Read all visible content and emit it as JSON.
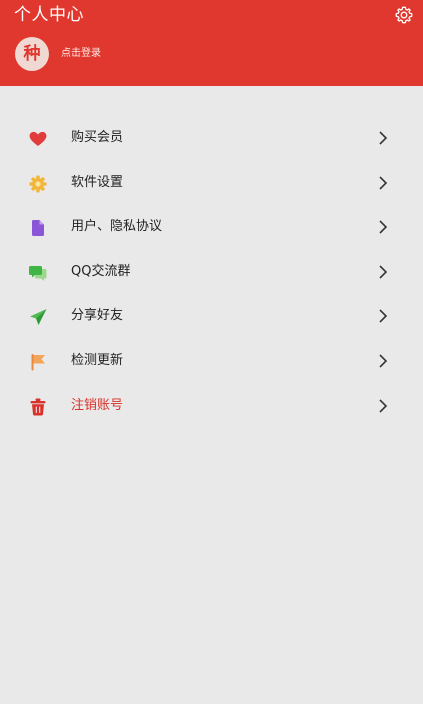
{
  "header": {
    "title": "个人中心",
    "settings_icon": "gear-icon",
    "avatar_text": "种",
    "login_label": "点击登录"
  },
  "colors": {
    "brand": "#e0382f",
    "background": "#e9e9e9",
    "danger_text": "#d9312b"
  },
  "menu": {
    "items": [
      {
        "label": "购买会员",
        "icon": "heart-icon"
      },
      {
        "label": "软件设置",
        "icon": "cog-icon"
      },
      {
        "label": "用户、隐私协议",
        "icon": "document-icon"
      },
      {
        "label": "QQ交流群",
        "icon": "chat-icon"
      },
      {
        "label": "分享好友",
        "icon": "paper-plane-icon"
      },
      {
        "label": "检测更新",
        "icon": "flag-icon"
      },
      {
        "label": "注销账号",
        "icon": "trash-icon"
      }
    ]
  }
}
